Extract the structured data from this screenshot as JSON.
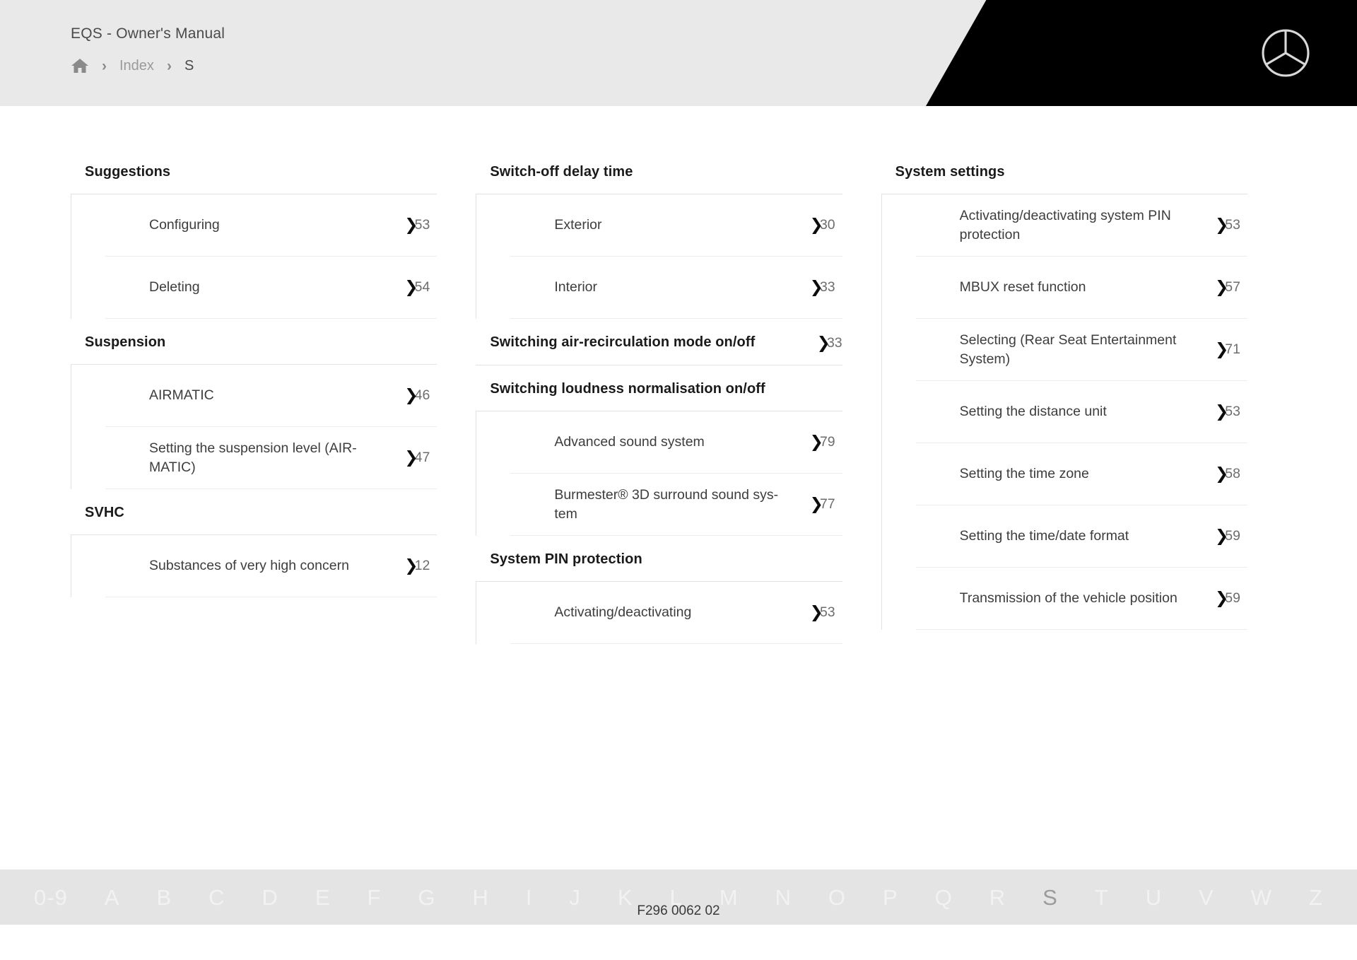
{
  "header": {
    "manual_title": "EQS - Owner's Manual",
    "breadcrumb": {
      "home_icon": "home-icon",
      "separator": "›",
      "index_label": "Index",
      "current_label": "S"
    },
    "brand_logo": "mercedes-benz-star-icon"
  },
  "columns": [
    {
      "groups": [
        {
          "heading": "Suggestions",
          "heading_pageref": null,
          "entries": [
            {
              "label": "Configuring",
              "page_prefix": "5",
              "page_suffix": "3",
              "chevron": "❯"
            },
            {
              "label": "Deleting",
              "page_prefix": "5",
              "page_suffix": "4",
              "chevron": "❯"
            }
          ]
        },
        {
          "heading": "Suspension",
          "heading_pageref": null,
          "entries": [
            {
              "label": "AIRMATIC",
              "page_prefix": "4",
              "page_suffix": "6",
              "chevron": "❯"
            },
            {
              "label": "Setting the suspension level (AIR-MATIC)",
              "page_prefix": "4",
              "page_suffix": "7",
              "chevron": "❯"
            }
          ]
        },
        {
          "heading": "SVHC",
          "heading_pageref": null,
          "entries": [
            {
              "label": "Substances of very high concern",
              "page_prefix": "1",
              "page_suffix": "2",
              "chevron": "❯"
            }
          ]
        }
      ]
    },
    {
      "groups": [
        {
          "heading": "Switch-off delay time",
          "heading_pageref": null,
          "entries": [
            {
              "label": "Exterior",
              "page_prefix": "3",
              "page_suffix": "0",
              "chevron": "❯"
            },
            {
              "label": "Interior",
              "page_prefix": "3",
              "page_suffix": "3",
              "chevron": "❯"
            }
          ]
        },
        {
          "heading": "Switching air-recirculation mode on/off",
          "heading_pageref": {
            "page_prefix": "3",
            "page_suffix": "3",
            "chevron": "❯"
          },
          "entries": []
        },
        {
          "heading": "Switching loudness normalisation on/off",
          "heading_pageref": null,
          "entries": [
            {
              "label": "Advanced sound system",
              "page_prefix": "7",
              "page_suffix": "9",
              "chevron": "❯"
            },
            {
              "label": "Burmester® 3D surround sound sys-tem",
              "page_prefix": "7",
              "page_suffix": "7",
              "chevron": "❯"
            }
          ]
        },
        {
          "heading": "System PIN protection",
          "heading_pageref": null,
          "entries": [
            {
              "label": "Activating/deactivating",
              "page_prefix": "5",
              "page_suffix": "3",
              "chevron": "❯"
            }
          ]
        }
      ]
    },
    {
      "groups": [
        {
          "heading": "System settings",
          "heading_pageref": null,
          "entries": [
            {
              "label": "Activating/deactivating system PIN protection",
              "page_prefix": "5",
              "page_suffix": "3",
              "chevron": "❯"
            },
            {
              "label": "MBUX reset function",
              "page_prefix": "5",
              "page_suffix": "7",
              "chevron": "❯"
            },
            {
              "label": "Selecting (Rear Seat Entertainment System)",
              "page_prefix": "7",
              "page_suffix": "1",
              "chevron": "❯"
            },
            {
              "label": "Setting the distance unit",
              "page_prefix": "5",
              "page_suffix": "3",
              "chevron": "❯"
            },
            {
              "label": "Setting the time zone",
              "page_prefix": "5",
              "page_suffix": "8",
              "chevron": "❯"
            },
            {
              "label": "Setting the time/date format",
              "page_prefix": "5",
              "page_suffix": "9",
              "chevron": "❯"
            },
            {
              "label": "Transmission of the vehicle position",
              "page_prefix": "5",
              "page_suffix": "9",
              "chevron": "❯"
            }
          ]
        }
      ]
    }
  ],
  "alphabet_bar": {
    "active": "S",
    "items": [
      "0-9",
      "A",
      "B",
      "C",
      "D",
      "E",
      "F",
      "G",
      "H",
      "I",
      "J",
      "K",
      "L",
      "M",
      "N",
      "O",
      "P",
      "Q",
      "R",
      "S",
      "T",
      "U",
      "V",
      "W",
      "Z"
    ]
  },
  "footer": {
    "document_code": "F296 0062 02"
  },
  "colors": {
    "header_bg": "#e9e9e9",
    "header_accent": "#000000",
    "alpha_bar_bg": "#e4e4e4",
    "alpha_inactive": "#f2f2f2",
    "alpha_active": "#9b9b9b",
    "rule": "#e2e2e2",
    "text": "#3d3d3d",
    "heading": "#1a1a1a"
  }
}
